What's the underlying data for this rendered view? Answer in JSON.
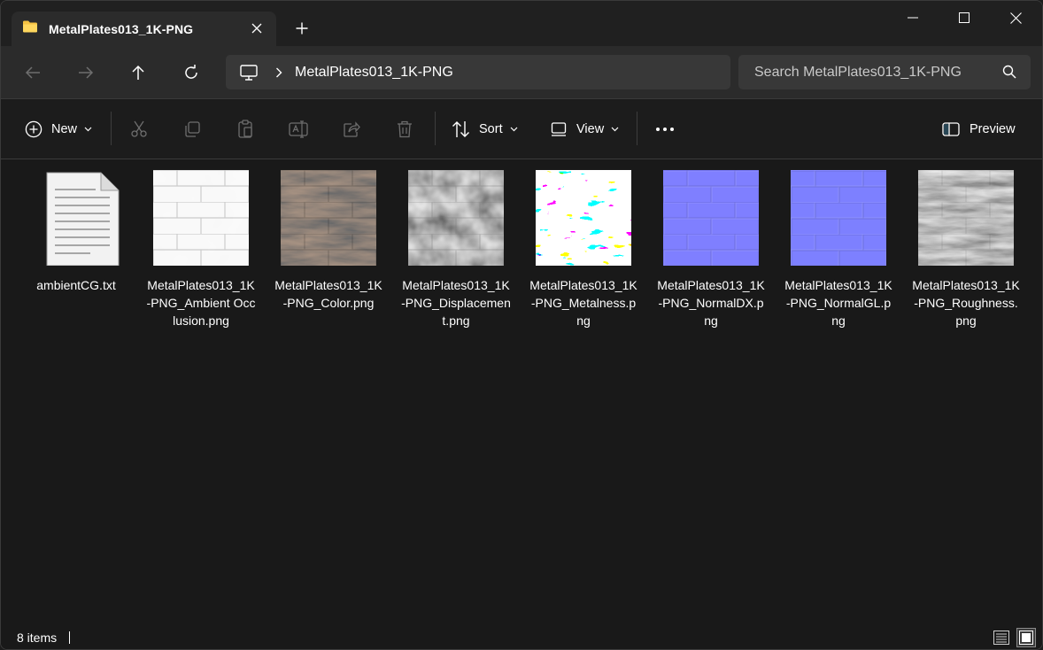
{
  "window": {
    "tab_title": "MetalPlates013_1K-PNG"
  },
  "address_bar": {
    "path": "MetalPlates013_1K-PNG"
  },
  "search": {
    "placeholder": "Search MetalPlates013_1K-PNG"
  },
  "command_bar": {
    "new_label": "New",
    "sort_label": "Sort",
    "view_label": "View",
    "preview_label": "Preview"
  },
  "files": [
    {
      "name": "ambientCG.txt",
      "icon": "text-file-icon"
    },
    {
      "name": "MetalPlates013_1K-PNG_AmbientOcclusion.png",
      "display": "MetalPlates013_1K-PNG_Ambient Occlusion.png",
      "icon": "ambient-occlusion-thumbnail"
    },
    {
      "name": "MetalPlates013_1K-PNG_Color.png",
      "icon": "color-thumbnail"
    },
    {
      "name": "MetalPlates013_1K-PNG_Displacement.png",
      "icon": "displacement-thumbnail"
    },
    {
      "name": "MetalPlates013_1K-PNG_Metalness.png",
      "icon": "metalness-thumbnail"
    },
    {
      "name": "MetalPlates013_1K-PNG_NormalDX.png",
      "icon": "normal-dx-thumbnail"
    },
    {
      "name": "MetalPlates013_1K-PNG_NormalGL.png",
      "icon": "normal-gl-thumbnail"
    },
    {
      "name": "MetalPlates013_1K-PNG_Roughness.png",
      "icon": "roughness-thumbnail"
    }
  ],
  "status_bar": {
    "item_count": "8 items"
  },
  "colors": {
    "accent": "#4cc2ff",
    "folder": "#f5c242"
  }
}
